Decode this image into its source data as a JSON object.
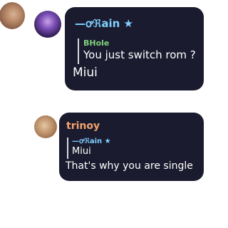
{
  "colors": {
    "bubble_bg": "#1b1b2f",
    "sender_rain": "#7fd0ff",
    "sender_trinoy": "#f3a36b",
    "quote_author_bhole": "#7fd37a"
  },
  "messages": [
    {
      "sender": "—ꝍℜain ★",
      "reply_to": {
        "author": "BHole",
        "text": "You just switch rom ?"
      },
      "text": "Miui"
    },
    {
      "sender": "trinoy",
      "reply_to": {
        "author": "—ꝍℜain ★",
        "text": "Miui"
      },
      "text": "That's why you are single"
    }
  ]
}
